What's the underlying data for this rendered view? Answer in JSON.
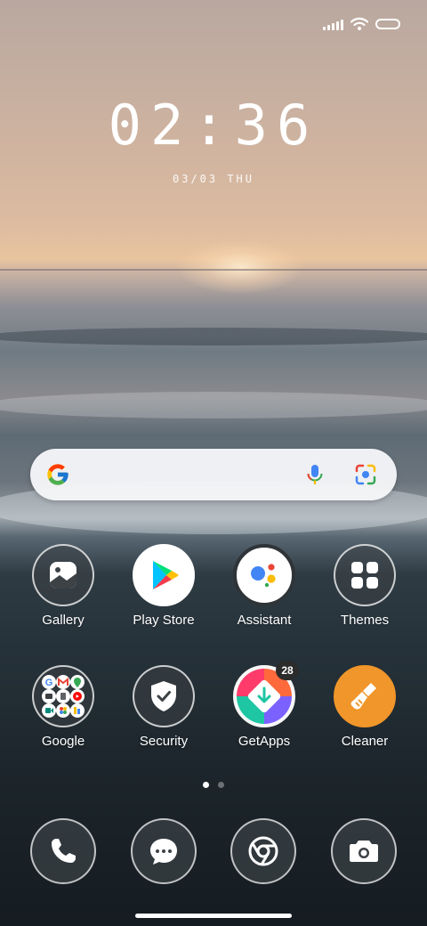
{
  "status": {
    "icons": [
      "signal-icon",
      "wifi-icon",
      "battery-icon"
    ]
  },
  "clock": {
    "time": "02:36",
    "date": "03/03 THU"
  },
  "search": {
    "icons": [
      "google-logo",
      "mic-icon",
      "lens-icon"
    ]
  },
  "apps": [
    {
      "label": "Gallery",
      "icon": "gallery-icon"
    },
    {
      "label": "Play Store",
      "icon": "play-store-icon"
    },
    {
      "label": "Assistant",
      "icon": "assistant-icon"
    },
    {
      "label": "Themes",
      "icon": "themes-icon"
    },
    {
      "label": "Google",
      "icon": "google-folder-icon"
    },
    {
      "label": "Security",
      "icon": "shield-icon"
    },
    {
      "label": "GetApps",
      "icon": "getapps-icon",
      "badge": "28"
    },
    {
      "label": "Cleaner",
      "icon": "broom-icon"
    }
  ],
  "page_indicator": {
    "count": 2,
    "active": 1
  },
  "dock": [
    {
      "icon": "phone-icon"
    },
    {
      "icon": "messages-icon"
    },
    {
      "icon": "chrome-icon"
    },
    {
      "icon": "camera-icon"
    }
  ],
  "colors": {
    "cleaner_orange": "#f0962a",
    "mic_blue": "#4285f4",
    "google_red": "#ea4335",
    "google_yellow": "#fbbc05",
    "google_green": "#34a853"
  }
}
